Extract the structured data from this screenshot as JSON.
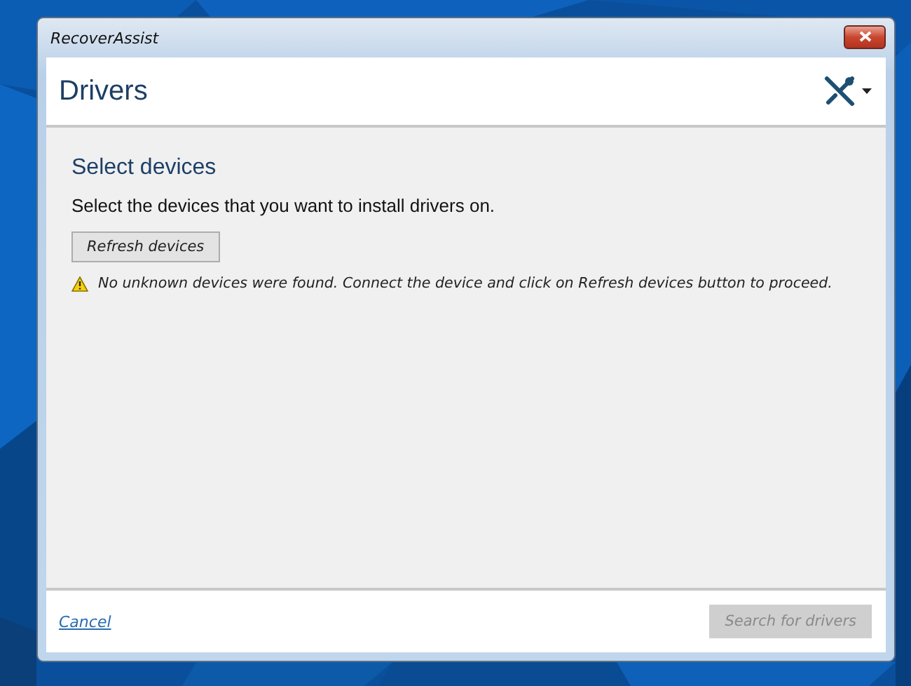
{
  "window": {
    "title": "RecoverAssist"
  },
  "header": {
    "title": "Drivers"
  },
  "section": {
    "heading": "Select devices",
    "instruction": "Select the devices that you want to install drivers on.",
    "refresh_button": {
      "label": "Refresh devices",
      "disabled": false
    },
    "warning": "No unknown devices were found. Connect the device and click on Refresh devices button to proceed."
  },
  "footer": {
    "cancel_link": "Cancel",
    "search_button": {
      "label": "Search for drivers",
      "disabled": true
    }
  }
}
